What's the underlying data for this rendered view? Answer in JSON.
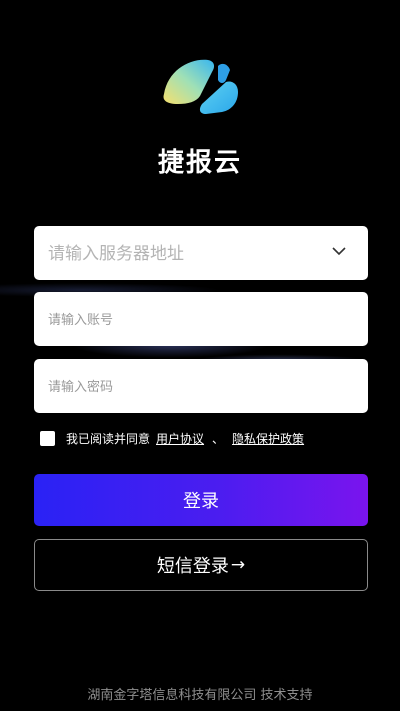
{
  "app": {
    "name": "捷报云"
  },
  "form": {
    "server": {
      "placeholder": "请输入服务器地址",
      "value": ""
    },
    "account": {
      "placeholder": "请输入账号",
      "value": ""
    },
    "password": {
      "placeholder": "请输入密码",
      "value": ""
    }
  },
  "agreement": {
    "checked": false,
    "prefix": "我已阅读并同意",
    "user_agreement": "用户协议",
    "separator": "、",
    "privacy_policy": "隐私保护政策"
  },
  "buttons": {
    "login": "登录",
    "sms_login": "短信登录",
    "sms_arrow": "→"
  },
  "footer": {
    "text": "湖南金字塔信息科技有限公司 技术支持"
  },
  "colors": {
    "background": "#000000",
    "login_gradient_start": "#2a22f5",
    "login_gradient_end": "#7a14ee",
    "logo_blue": "#4ec3ec",
    "logo_yellow": "#f3dc72"
  },
  "icons": {
    "logo": "app-logo-icon",
    "dropdown": "chevron-down-icon",
    "arrow": "arrow-right-icon"
  }
}
